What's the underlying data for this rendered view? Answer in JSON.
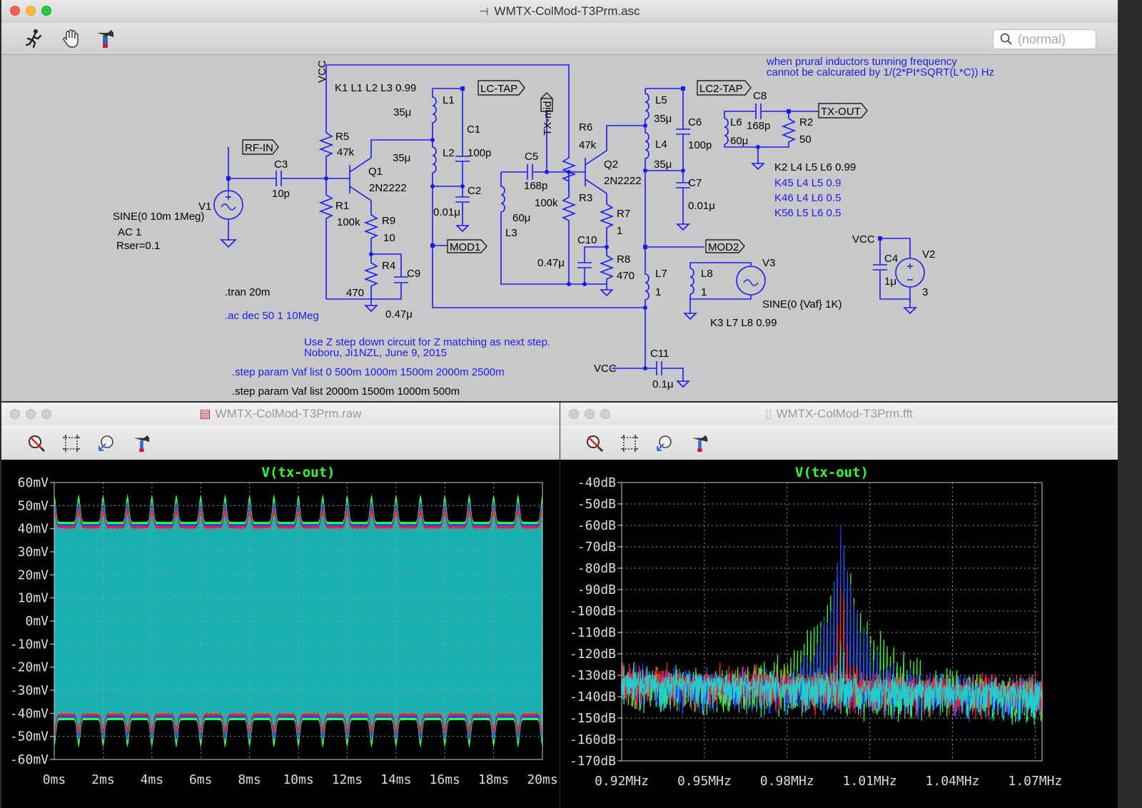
{
  "schematic": {
    "window_title": "WMTX-ColMod-T3Prm.asc",
    "search_placeholder": "(normal)",
    "tools": [
      "run-icon",
      "halt-hand-icon",
      "hammer-icon"
    ],
    "note_top_1": "when prural inductors tunning frequency",
    "note_top_2": "cannot be calcurated by 1/(2*PI*SQRT(L*C)) Hz",
    "coupling_1": "K1 L1 L2 L3 0.99",
    "coupling_2": "K2 L4 L5 L6 0.99",
    "coupling_3": "K45 L4 L5  0.9",
    "coupling_4": "K46 L4 L6  0.5",
    "coupling_5": "K56 L5 L6  0.5",
    "coupling_6": "K3 L7 L8 0.99",
    "labels": {
      "vcc": "VCC",
      "rf_in": "RF-IN",
      "lc_tap": "LC-TAP",
      "lc2_tap": "LC2-TAP",
      "tx_out": "TX-OUT",
      "tx_mid": "TX-mid",
      "mod1": "MOD1",
      "mod2": "MOD2"
    },
    "components": {
      "V1": "V1",
      "V1_val": "SINE(0 10m 1Meg)",
      "V1_ac": "AC 1",
      "V1_rser": "Rser=0.1",
      "C3": "C3",
      "C3_val": "10p",
      "R5": "R5",
      "R5_val": "47k",
      "R1": "R1",
      "R1_val": "100k",
      "Q1": "Q1",
      "Q1_val": "2N2222",
      "R9": "R9",
      "R9_val": "10",
      "R4": "R4",
      "R4_val": "470",
      "C9": "C9",
      "C9_val": "0.47μ",
      "L1": "L1",
      "L1_val": "35μ",
      "L2": "L2",
      "L2_val": "35μ",
      "C1": "C1",
      "C1_val": "100p",
      "C2": "C2",
      "C2_val": "0.01μ",
      "C5": "C5",
      "C5_val": "168p",
      "L3": "L3",
      "L3_val": "60μ",
      "R6": "R6",
      "R6_val": "47k",
      "R3": "R3",
      "R3_val": "100k",
      "Q2": "Q2",
      "Q2_val": "2N2222",
      "R7": "R7",
      "R7_val": "1",
      "C10": "C10",
      "C10_val": "0.47μ",
      "R8": "R8",
      "R8_val": "470",
      "L5": "L5",
      "L5_val": "35μ",
      "L4": "L4",
      "L4_val": "35μ",
      "C6": "C6",
      "C6_val": "100p",
      "C7": "C7",
      "C7_val": "0.01μ",
      "L6": "L6",
      "L6_val": "60μ",
      "C8": "C8",
      "C8_val": "168p",
      "R2": "R2",
      "R2_val": "50",
      "L7": "L7",
      "L7_val": "1",
      "L8": "L8",
      "L8_val": "1",
      "V3": "V3",
      "V3_val": "SINE(0 {Vaf} 1K)",
      "C11": "C11",
      "C11_val": "0.1μ",
      "V2": "V2",
      "V2_val": "3",
      "C4": "C4",
      "C4_val": "1μ"
    },
    "directives": {
      "tran": ".tran 20m",
      "ac": ".ac dec 50 1 10Meg",
      "comment_1": "Use Z step down circuit for Z matching as next step.",
      "comment_2": "Noboru, Ji1NZL, June 9, 2015",
      "step_1": ".step param Vaf list 0 500m 1000m 1500m 2000m 2500m",
      "step_2": ".step param Vaf list 2000m 1500m 1000m 500m"
    }
  },
  "raw_window": {
    "title": "WMTX-ColMod-T3Prm.raw"
  },
  "fft_window": {
    "title": "WMTX-ColMod-T3Prm.fft"
  },
  "plot_tools": [
    "zoom-cancel-icon",
    "zoom-area-icon",
    "autorange-icon",
    "hammer-icon"
  ],
  "colors": {
    "trace_title": "#33ff33",
    "teal": "#1ab0b0",
    "green": "#33ff33",
    "blue": "#2244ff",
    "red": "#ff2222",
    "cyan": "#22cccc",
    "schematic_blue": "#1a1aff"
  },
  "chart_data": [
    {
      "type": "line",
      "title": "V(tx-out)",
      "xlabel": "",
      "ylabel": "",
      "x_ticks": [
        "0ms",
        "2ms",
        "4ms",
        "6ms",
        "8ms",
        "10ms",
        "12ms",
        "14ms",
        "16ms",
        "18ms",
        "20ms"
      ],
      "y_ticks": [
        "60mV",
        "50mV",
        "40mV",
        "30mV",
        "20mV",
        "10mV",
        "0mV",
        "-10mV",
        "-20mV",
        "-30mV",
        "-40mV",
        "-50mV",
        "-60mV"
      ],
      "xlim": [
        0,
        20
      ],
      "ylim": [
        -60,
        60
      ],
      "grid": true,
      "x_unit": "ms",
      "y_unit": "mV",
      "envelope_cycles": 20,
      "series": [
        {
          "color": "#33ff33",
          "upper_max": 55,
          "upper_min": 43,
          "lower_max": -43,
          "lower_min": -55
        },
        {
          "color": "#2244ff",
          "upper_max": 52,
          "upper_min": 42,
          "lower_max": -42,
          "lower_min": -52
        },
        {
          "color": "#ff2222",
          "upper_max": 49,
          "upper_min": 41,
          "lower_max": -41,
          "lower_min": -49
        },
        {
          "color": "#1ab0b0",
          "upper_max": 46,
          "upper_min": 40,
          "lower_max": -40,
          "lower_min": -46
        }
      ]
    },
    {
      "type": "line",
      "title": "V(tx-out)",
      "xlabel": "",
      "ylabel": "",
      "x_ticks": [
        "0.92MHz",
        "0.95MHz",
        "0.98MHz",
        "1.01MHz",
        "1.04MHz",
        "1.07MHz"
      ],
      "y_ticks": [
        "-40dB",
        "-50dB",
        "-60dB",
        "-70dB",
        "-80dB",
        "-90dB",
        "-100dB",
        "-110dB",
        "-120dB",
        "-130dB",
        "-140dB",
        "-150dB",
        "-160dB",
        "-170dB"
      ],
      "xlim": [
        0.92,
        1.0725
      ],
      "ylim": [
        -170,
        -40
      ],
      "grid": true,
      "x_unit": "MHz",
      "y_unit": "dB",
      "peak_x": 1.0,
      "series": [
        {
          "color": "#33ff33",
          "peak_db": -63,
          "spread": 0.018,
          "floor_db": -132,
          "sideband_db": -85
        },
        {
          "color": "#2244ff",
          "peak_db": -52,
          "spread": 0.012,
          "floor_db": -131,
          "sideband_db": -90
        },
        {
          "color": "#ff2222",
          "peak_db": -75,
          "spread": 0.006,
          "floor_db": -130,
          "sideband_db": -115
        },
        {
          "color": "#22cccc",
          "peak_db": -100,
          "spread": 0.004,
          "floor_db": -131,
          "sideband_db": -125
        }
      ]
    }
  ]
}
